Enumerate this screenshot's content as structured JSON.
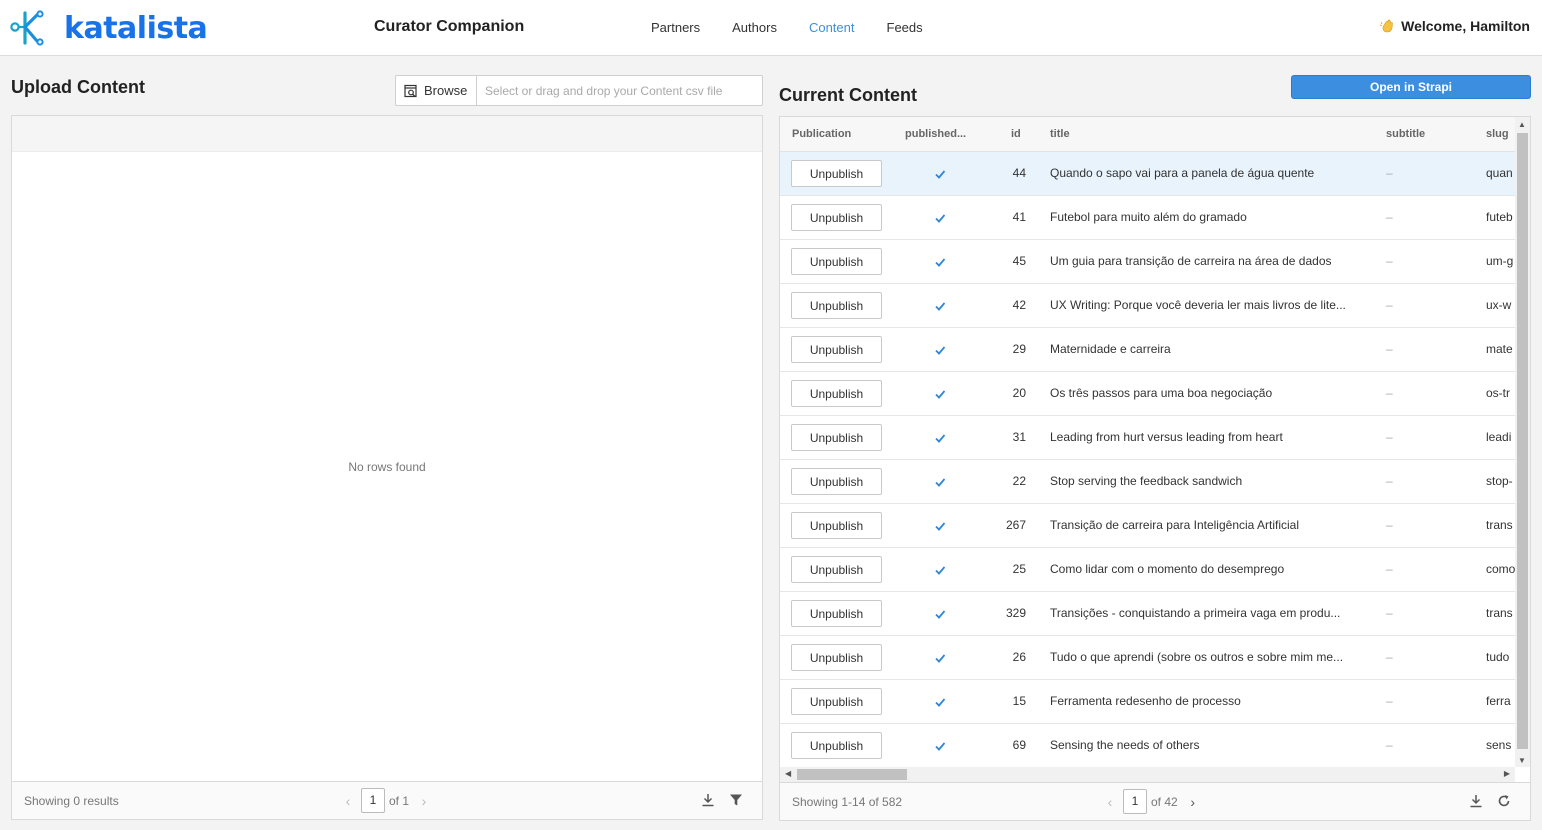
{
  "header": {
    "logo_text": "katalista",
    "app_title": "Curator Companion",
    "nav": [
      {
        "label": "Partners",
        "active": false
      },
      {
        "label": "Authors",
        "active": false
      },
      {
        "label": "Content",
        "active": true
      },
      {
        "label": "Feeds",
        "active": false
      }
    ],
    "welcome": "Welcome, Hamilton",
    "accent_color": "#1a72e8"
  },
  "upload": {
    "title": "Upload Content",
    "browse_label": "Browse",
    "file_placeholder": "Select or drag and drop your Content csv file",
    "empty_message": "No rows found",
    "footer": {
      "showing": "Showing 0 results",
      "page": "1",
      "of": "of 1"
    }
  },
  "current": {
    "title": "Current Content",
    "open_strapi_label": "Open in Strapi",
    "columns": {
      "publication": "Publication",
      "published": "published...",
      "id": "id",
      "title": "title",
      "subtitle": "subtitle",
      "slug": "slug"
    },
    "rows": [
      {
        "action": "Unpublish",
        "id": "44",
        "title": "Quando o sapo vai para a panela de água quente",
        "subtitle": "–",
        "slug": "quan"
      },
      {
        "action": "Unpublish",
        "id": "41",
        "title": "Futebol para muito além do gramado",
        "subtitle": "–",
        "slug": "futeb"
      },
      {
        "action": "Unpublish",
        "id": "45",
        "title": "Um guia para transição de carreira na área de dados",
        "subtitle": "–",
        "slug": "um-g"
      },
      {
        "action": "Unpublish",
        "id": "42",
        "title": "UX Writing: Porque você deveria ler mais livros de lite...",
        "subtitle": "–",
        "slug": "ux-w"
      },
      {
        "action": "Unpublish",
        "id": "29",
        "title": "Maternidade e carreira",
        "subtitle": "–",
        "slug": "mate"
      },
      {
        "action": "Unpublish",
        "id": "20",
        "title": "Os três passos para uma boa negociação",
        "subtitle": "–",
        "slug": "os-tr"
      },
      {
        "action": "Unpublish",
        "id": "31",
        "title": "Leading from hurt versus leading from heart",
        "subtitle": "–",
        "slug": "leadi"
      },
      {
        "action": "Unpublish",
        "id": "22",
        "title": "Stop serving the feedback sandwich",
        "subtitle": "–",
        "slug": "stop-"
      },
      {
        "action": "Unpublish",
        "id": "267",
        "title": "Transição de carreira para Inteligência Artificial",
        "subtitle": "–",
        "slug": "trans"
      },
      {
        "action": "Unpublish",
        "id": "25",
        "title": "Como lidar com o momento do desemprego",
        "subtitle": "–",
        "slug": "como"
      },
      {
        "action": "Unpublish",
        "id": "329",
        "title": "Transições - conquistando a primeira vaga em produ...",
        "subtitle": "–",
        "slug": "trans"
      },
      {
        "action": "Unpublish",
        "id": "26",
        "title": "Tudo o que aprendi (sobre os outros e sobre mim me...",
        "subtitle": "–",
        "slug": "tudo"
      },
      {
        "action": "Unpublish",
        "id": "15",
        "title": "Ferramenta redesenho de processo",
        "subtitle": "–",
        "slug": "ferra"
      },
      {
        "action": "Unpublish",
        "id": "69",
        "title": "Sensing the needs of others",
        "subtitle": "–",
        "slug": "sens"
      }
    ],
    "footer": {
      "showing": "Showing 1-14 of 582",
      "page": "1",
      "of": "of 42"
    }
  }
}
